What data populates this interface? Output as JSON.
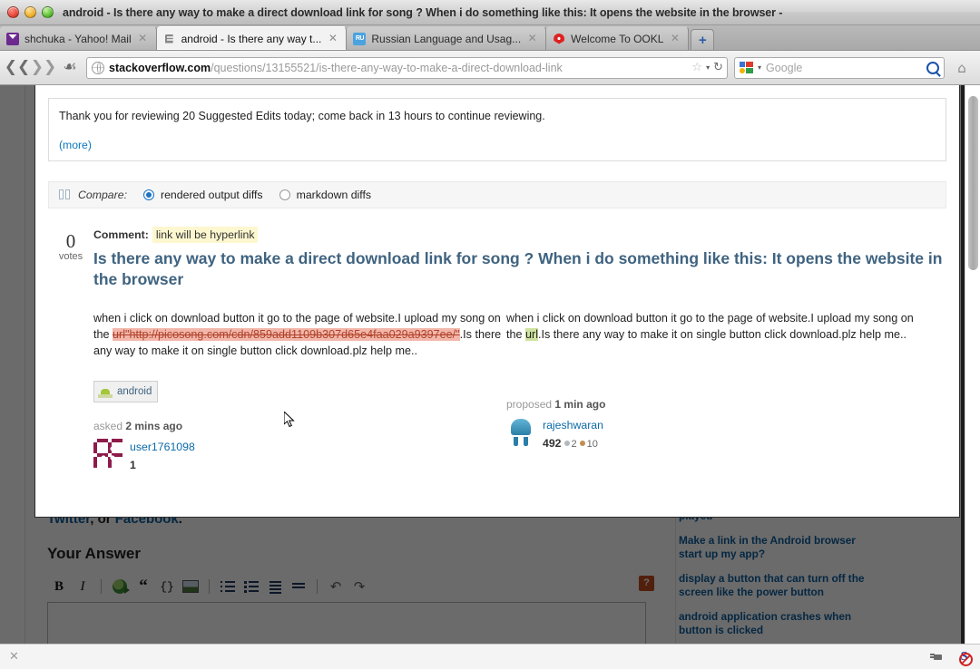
{
  "window": {
    "title": "android - Is there any way to make a direct download link for song ? When i do something like this: It opens the website in the browser -"
  },
  "tabs": [
    {
      "label": "shchuka - Yahoo! Mail",
      "favicon": "yahoo-mail-icon",
      "active": false,
      "close_label": "✕"
    },
    {
      "label": "android - Is there any way t...",
      "favicon": "stackoverflow-icon",
      "active": true,
      "close_label": "✕"
    },
    {
      "label": "Russian Language and Usag...",
      "favicon": "ru-stackexchange-icon",
      "active": false,
      "close_label": "✕"
    },
    {
      "label": "Welcome To OOKL",
      "favicon": "ookl-icon",
      "active": false,
      "close_label": "✕"
    }
  ],
  "newtab_label": "+",
  "nav": {
    "back_icon": "back-arrow-icon",
    "forward_icon": "forward-arrow-icon",
    "shield_icon": "shield-icon",
    "url_host": "stackoverflow.com",
    "url_path": "/questions/13155521/is-there-any-way-to-make-a-direct-download-link",
    "star_icon": "☆",
    "caret_icon": "▾",
    "reload_icon": "↻",
    "home_icon": "⌂",
    "search_engine": "Google",
    "search_placeholder": "Google",
    "search_value": ""
  },
  "modal": {
    "notice": {
      "text": "Thank you for reviewing 20 Suggested Edits today; come back in 13 hours to continue reviewing.",
      "more_label": "(more)"
    },
    "compare": {
      "icon": "compare-pages-icon",
      "label": "Compare:",
      "options": [
        {
          "label": "rendered output diffs",
          "selected": true
        },
        {
          "label": "markdown diffs",
          "selected": false
        }
      ]
    },
    "post": {
      "votes": "0",
      "votes_label": "votes",
      "comment_label": "Comment:",
      "comment_value": "link will be hyperlink",
      "title": "Is there any way to make a direct download link for song ? When i do something like this: It opens the website in the browser",
      "left_diff": {
        "before": "when i click on download button it go to the page of website.I upload my song on the ",
        "deleted": "url\"http://picosong.com/cdn/859add1109b307d65e4faa029a9397ee/\"",
        "after": ".Is there any way to make it on single button click download.plz help me.."
      },
      "right_diff": {
        "before": "when i click on download button it go to the page of website.I upload my song on the ",
        "inserted": "url",
        "after": ".Is there any way to make it on single button click download.plz help me.."
      },
      "tag": {
        "label": "android",
        "icon": "android-robot-icon"
      },
      "left_meta": {
        "action": "asked",
        "time": "2 mins ago",
        "user": "user1761098",
        "reputation": "1",
        "avatar": "identicon-avatar"
      },
      "right_meta": {
        "action": "proposed",
        "time": "1 min ago",
        "user": "rajeshwaran",
        "reputation": "492",
        "silver_badges": "2",
        "bronze_badges": "10",
        "avatar": "android-avatar"
      }
    }
  },
  "background_page": {
    "share_line": {
      "prefix": "Twitter",
      "mid": ", or ",
      "link": "Facebook",
      "suffix": "."
    },
    "your_answer_heading": "Your Answer",
    "editor_toolbar": [
      {
        "name": "bold-button",
        "label": "B"
      },
      {
        "name": "italic-button",
        "label": "I"
      },
      {
        "name": "link-button",
        "label": ""
      },
      {
        "name": "blockquote-button",
        "label": "“"
      },
      {
        "name": "code-button",
        "label": "{}"
      },
      {
        "name": "image-button",
        "label": ""
      },
      {
        "name": "numbered-list-button",
        "label": ""
      },
      {
        "name": "bulleted-list-button",
        "label": ""
      },
      {
        "name": "heading-button",
        "label": ""
      },
      {
        "name": "horizontal-rule-button",
        "label": ""
      },
      {
        "name": "undo-button",
        "label": "↶"
      },
      {
        "name": "redo-button",
        "label": "↷"
      }
    ],
    "help_label": "?",
    "answer_placeholder": "",
    "related_links": [
      "played",
      "Make a link in the Android browser start up my app?",
      "display a button that can turn off the screen like the power button",
      "android application crashes when button is clicked"
    ]
  },
  "statusbar": {
    "close_icon": "✕",
    "plug_icon": "plug-icon",
    "script_blocked_icon": "noscript-icon"
  },
  "colors": {
    "link": "#0b6aa8",
    "title": "#3f6380",
    "deleted_bg": "#f2b7aa",
    "deleted_fg": "#b0412a",
    "inserted_bg": "#cfe3a0",
    "highlight_bg": "#fdf7cf",
    "radio_accent": "#1b72c4"
  }
}
